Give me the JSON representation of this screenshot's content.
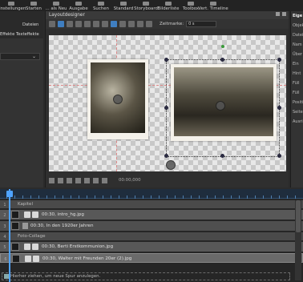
{
  "menu": {
    "items": [
      {
        "label": "Einstellungen",
        "icon": "settings-icon"
      },
      {
        "label": "Starten",
        "icon": "play-icon"
      },
      {
        "label": "... als Neu",
        "icon": "new-icon"
      },
      {
        "label": "Ausgabe",
        "icon": "export-icon"
      },
      {
        "label": "Suchen",
        "icon": "search-icon"
      },
      {
        "label": "Standard",
        "icon": "layout-icon"
      },
      {
        "label": "Storyboard",
        "icon": "storyboard-icon"
      },
      {
        "label": "Bilderliste",
        "icon": "list-icon"
      },
      {
        "label": "Toolbox",
        "icon": "toolbox-icon"
      },
      {
        "label": "Vert. Timeline",
        "icon": "timeline-icon"
      }
    ]
  },
  "left_panel": {
    "tabs": [
      "Dateien",
      "Effekte",
      "Texteffekte"
    ]
  },
  "designer": {
    "title": "Layoutdesigner",
    "zeitmarke_label": "Zeitmarke:",
    "zeitmarke_value": "0 s",
    "timecode": "00:00,000"
  },
  "right_panel": {
    "lines": [
      "Eige",
      "Objekt",
      "Datei",
      "Nam",
      "Über",
      "Ein",
      "Hint",
      "Füll",
      "Füll",
      "Positi",
      "Seite",
      "Ausri"
    ]
  },
  "timeline": {
    "tracks": [
      {
        "type": "group",
        "label": "Kapitel",
        "no": "1"
      },
      {
        "type": "clip",
        "label": "00:30, intro_hg.jpg",
        "no": "2"
      },
      {
        "type": "text",
        "label": "00:30, In den 1920er Jahren",
        "no": "3"
      },
      {
        "type": "group",
        "label": "Foto-Collage",
        "no": "4"
      },
      {
        "type": "clip",
        "label": "00:30, Berti Erstkommunion.jpg",
        "no": "5"
      },
      {
        "type": "clip-selected",
        "label": "00:30, Walter mit Freunden 20er (2).jpg",
        "no": "6"
      }
    ],
    "hint": "Hierher ziehen, um neue Spur anzulegen."
  },
  "colors": {
    "accent": "#4fa3ff",
    "canvas_checker": "#c8c8c8",
    "guide": "#dd8888"
  }
}
